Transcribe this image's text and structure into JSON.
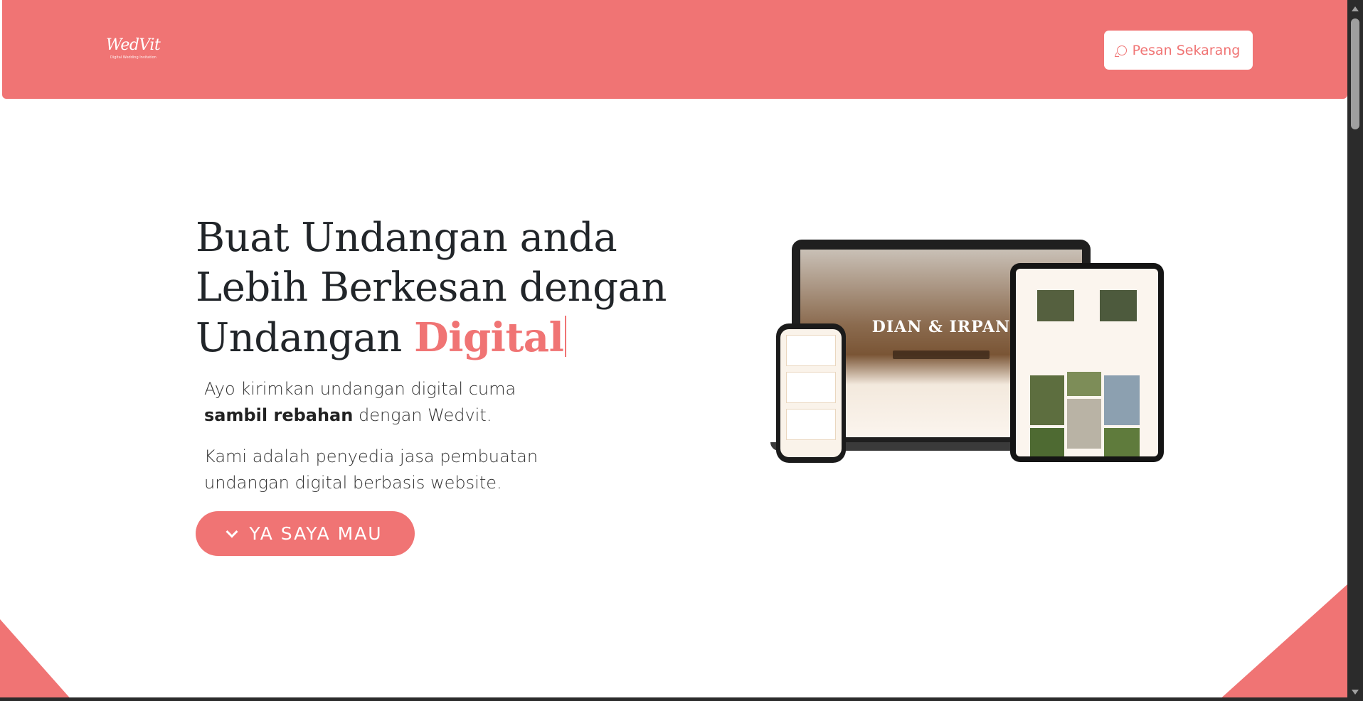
{
  "navbar": {
    "logo_text": "WedVit",
    "logo_tagline": "Digital Wedding Invitation",
    "order_button_label": "Pesan Sekarang",
    "order_button_icon": "whatsapp-icon",
    "background_color": "#f07474"
  },
  "hero": {
    "title_part1": "Buat Undangan anda",
    "title_part2": "Lebih Berkesan dengan",
    "title_part3": "Undangan ",
    "title_accent": "Digital",
    "paragraph1_part1": "Ayo kirimkan undangan digital cuma ",
    "paragraph1_bold": "sambil rebahan",
    "paragraph1_part2": " dengan Wedvit.",
    "paragraph2": "Kami adalah penyedia jasa pembuatan undangan digital berbasis website.",
    "cta_label": "YA SAYA MAU",
    "cta_icon": "chevron-down-icon"
  },
  "mockup": {
    "laptop_names": "DIAN & IRPAN"
  },
  "colors": {
    "accent": "#f07474",
    "text_dark": "#212529"
  }
}
